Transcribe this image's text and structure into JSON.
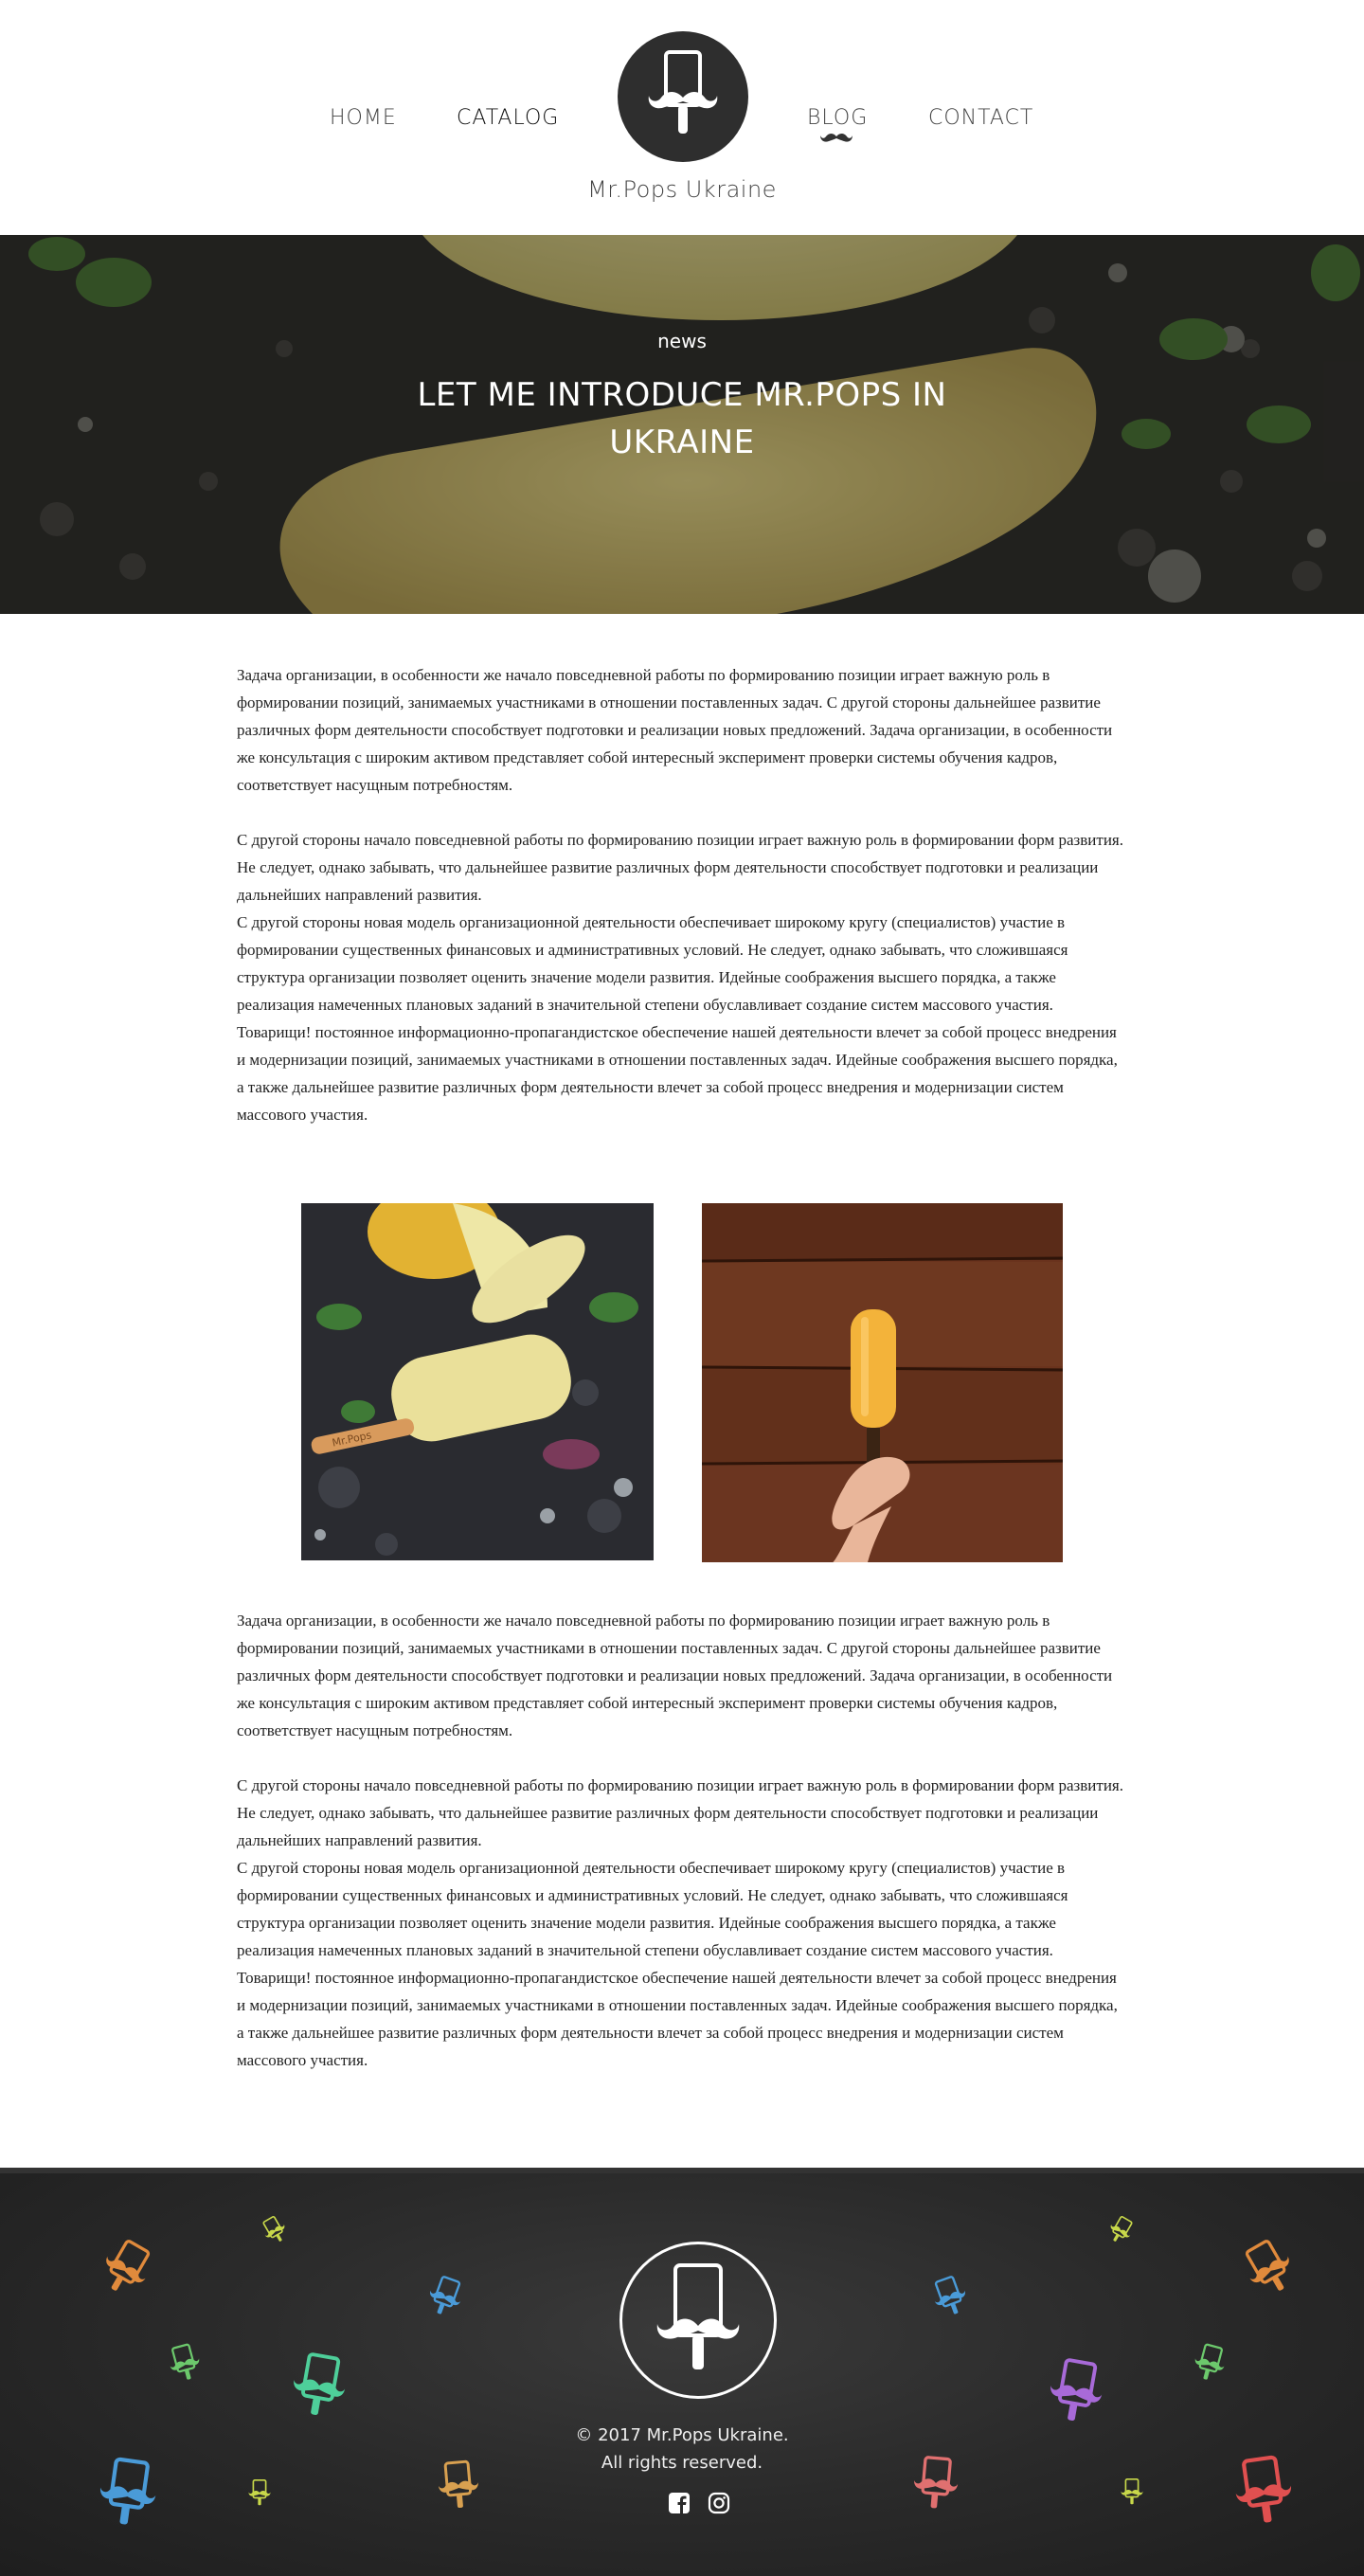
{
  "header": {
    "nav": {
      "home": "HOME",
      "catalog": "CATALOG",
      "blog": "BLOG",
      "contact": "CONTACT"
    },
    "active_nav": "blog",
    "brand": "Mr.Pops Ukraine"
  },
  "hero": {
    "kicker": "news",
    "title": "LET ME INTRODUCE MR.POPS IN UKRAINE"
  },
  "article": {
    "section1": {
      "p1": "Задача организации, в особенности же начало повседневной работы по формированию позиции играет важную роль в формировании позиций, занимаемых участниками в отношении поставленных задач. С другой стороны дальнейшее развитие различных форм деятельности способствует подготовки и реализации новых предложений. Задача организации, в особенности же консультация с широким активом представляет собой интересный эксперимент проверки системы обучения кадров, соответствует насущным потребностям.",
      "p2": "С другой стороны начало повседневной работы по формированию позиции играет важную роль в формировании форм развития. Не следует, однако забывать, что дальнейшее развитие различных форм деятельности способствует подготовки и реализации дальнейших направлений развития.",
      "p3": "С другой стороны новая модель организационной деятельности обеспечивает широкому кругу (специалистов) участие в формировании существенных финансовых и административных условий. Не следует, однако забывать, что сложившаяся структура организации позволяет оценить значение модели развития. Идейные соображения высшего порядка, а также реализация намеченных плановых заданий в значительной степени обуславливает создание систем массового участия. Товарищи! постоянное информационно-пропагандистское обеспечение нашей деятельности влечет за собой процесс внедрения и модернизации позиций, занимаемых участниками в отношении поставленных задач. Идейные соображения высшего порядка, а также дальнейшее развитие различных форм деятельности влечет за собой процесс внедрения и модернизации систем массового участия."
    },
    "section2": {
      "p1": "Задача организации, в особенности же начало повседневной работы по формированию позиции играет важную роль в формировании позиций, занимаемых участниками в отношении поставленных задач. С другой стороны дальнейшее развитие различных форм деятельности способствует подготовки и реализации новых предложений. Задача организации, в особенности же консультация с широким активом представляет собой интересный эксперимент проверки системы обучения кадров, соответствует насущным потребностям.",
      "p2": "С другой стороны начало повседневной работы по формированию позиции играет важную роль в формировании форм развития. Не следует, однако забывать, что дальнейшее развитие различных форм деятельности способствует подготовки и реализации дальнейших направлений развития.",
      "p3": "С другой стороны новая модель организационной деятельности обеспечивает широкому кругу (специалистов) участие в формировании существенных финансовых и административных условий. Не следует, однако забывать, что сложившаяся структура организации позволяет оценить значение модели развития. Идейные соображения высшего порядка, а также реализация намеченных плановых заданий в значительной степени обуславливает создание систем массового участия. Товарищи! постоянное информационно-пропагандистское обеспечение нашей деятельности влечет за собой процесс внедрения и модернизации позиций, занимаемых участниками в отношении поставленных задач. Идейные соображения высшего порядка, а также дальнейшее развитие различных форм деятельности влечет за собой процесс внедрения и модернизации систем массового участия."
    },
    "photo_stick_text": "Mr.Pops"
  },
  "footer": {
    "copyright_line1": "© 2017 Mr.Pops Ukraine.",
    "copyright_line2": "All rights reserved.",
    "social": [
      "facebook-icon",
      "instagram-icon"
    ]
  },
  "colors": {
    "header_bg": "#ffffff",
    "logo_bg": "#2e2e2e",
    "footer_bg": "#2a2a2a",
    "text": "#222222",
    "deco": [
      "#e08a3c",
      "#c8d84a",
      "#4a9bd8",
      "#6cc86c",
      "#4ecf9a",
      "#a86ad8",
      "#e05050",
      "#e07070"
    ]
  }
}
